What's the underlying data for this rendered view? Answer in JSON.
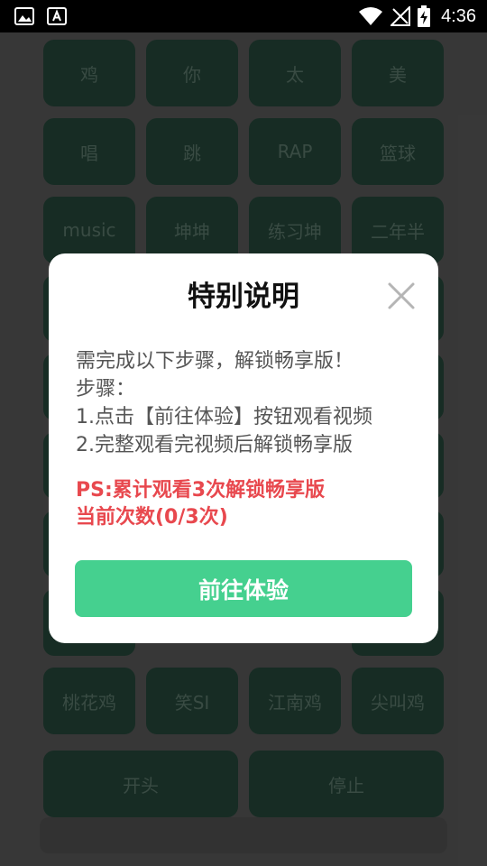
{
  "status_bar": {
    "time": "4:36",
    "icons": [
      "image-icon",
      "font-icon",
      "wifi-icon",
      "no-signal-icon",
      "battery-charging-icon"
    ]
  },
  "grid": {
    "rows": [
      [
        "鸡",
        "你",
        "太",
        "美"
      ],
      [
        "唱",
        "跳",
        "RAP",
        "篮球"
      ],
      [
        "music",
        "坤坤",
        "练习坤",
        "二年半"
      ],
      [
        "桃花鸡",
        "笑SI",
        "江南鸡",
        "尖叫鸡"
      ]
    ],
    "controls": [
      "开头",
      "停止"
    ]
  },
  "dialog": {
    "title": "特别说明",
    "lines": [
      "需完成以下步骤，解锁畅享版！",
      "步骤：",
      "1.点击【前往体验】按钮观看视频",
      "2.完整观看完视频后解锁畅享版"
    ],
    "note_lines": [
      "PS:累计观看3次解锁畅享版",
      "当前次数(0/3次)"
    ],
    "button_label": "前往体验",
    "close_icon": "close-icon"
  },
  "colors": {
    "button": "#45d08f",
    "note": "#e8484e",
    "cell": "#0a2a1e",
    "cell_text": "#3e5a4e"
  }
}
